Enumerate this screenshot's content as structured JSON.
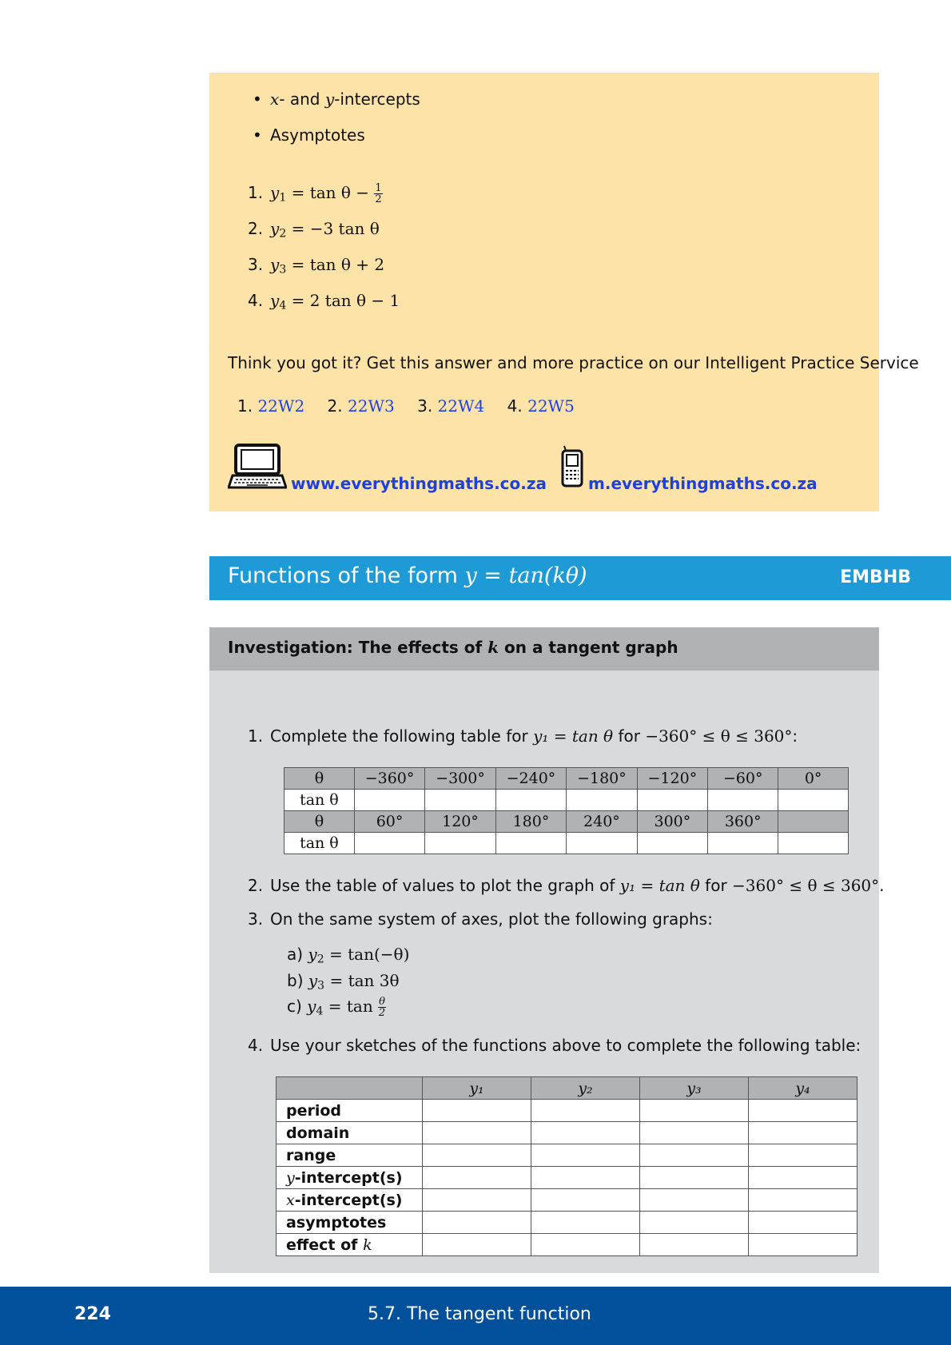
{
  "exercise": {
    "bullets": [
      "- and ",
      "-intercepts",
      "Asymptotes"
    ],
    "problems": [
      {
        "num": "1.",
        "lhs": "y",
        "sub": "1",
        "rhs": " = tan θ − ",
        "frac_num": "1",
        "frac_den": "2"
      },
      {
        "num": "2.",
        "lhs": "y",
        "sub": "2",
        "rhs": " = −3 tan θ"
      },
      {
        "num": "3.",
        "lhs": "y",
        "sub": "3",
        "rhs": " = tan θ + 2"
      },
      {
        "num": "4.",
        "lhs": "y",
        "sub": "4",
        "rhs": " = 2 tan θ − 1"
      }
    ],
    "practice_text": "Think you got it? Get this answer and more practice on our Intelligent Practice Service",
    "answers": [
      {
        "num": "1.",
        "code": "22W2"
      },
      {
        "num": "2.",
        "code": "22W3"
      },
      {
        "num": "3.",
        "code": "22W4"
      },
      {
        "num": "4.",
        "code": "22W5"
      }
    ],
    "website": "www.everythingmaths.co.za",
    "mobile": "m.everythingmaths.co.za"
  },
  "section": {
    "title_prefix": "Functions of the form ",
    "title_math": "y = tan(kθ)",
    "code": "EMBHB"
  },
  "investigation": {
    "title_prefix": "Investigation:  The effects of ",
    "title_var": "k",
    "title_suffix": " on a tangent graph",
    "step1": {
      "num": "1.",
      "text_a": "Complete the following table for ",
      "math": "y₁ = tan θ",
      "text_b": " for ",
      "range": "−360° ≤ θ ≤ 360°",
      "end": ":"
    },
    "values_table": {
      "row1_label": "θ",
      "row1": [
        "−360°",
        "−300°",
        "−240°",
        "−180°",
        "−120°",
        "−60°",
        "0°"
      ],
      "row2_label": "tan θ",
      "row3_label": "θ",
      "row3": [
        "60°",
        "120°",
        "180°",
        "240°",
        "300°",
        "360°",
        ""
      ],
      "row4_label": "tan θ"
    },
    "step2": {
      "num": "2.",
      "text_a": "Use the table of values to plot the graph of ",
      "math": "y₁ = tan θ",
      "text_b": " for ",
      "range": "−360° ≤ θ ≤ 360°",
      "end": "."
    },
    "step3": {
      "num": "3.",
      "text": "On the same system of axes, plot the following graphs:"
    },
    "sub_steps": [
      {
        "label": "a)",
        "lhs": "y",
        "sub": "2",
        "rhs": " = tan(−θ)"
      },
      {
        "label": "b)",
        "lhs": "y",
        "sub": "3",
        "rhs": " = tan 3θ"
      },
      {
        "label": "c)",
        "lhs": "y",
        "sub": "4",
        "rhs": " = tan ",
        "frac_num": "θ",
        "frac_den": "2"
      }
    ],
    "step4": {
      "num": "4.",
      "text": "Use your sketches of the functions above to complete the following table:"
    },
    "props_table": {
      "columns": [
        "y₁",
        "y₂",
        "y₃",
        "y₄"
      ],
      "rows": [
        "period",
        "domain",
        "range",
        "-intercept(s)",
        "-intercept(s)",
        "asymptotes",
        "effect of "
      ],
      "row_vars": [
        "",
        "",
        "",
        "y",
        "x",
        "",
        "k"
      ]
    }
  },
  "footer": {
    "page": "224",
    "chapter": "5.7.   The tangent function"
  }
}
